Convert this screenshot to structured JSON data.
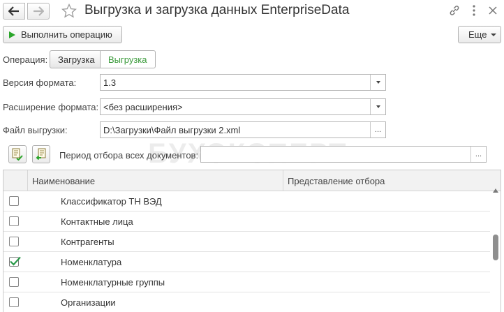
{
  "window": {
    "title": "Выгрузка и загрузка данных EnterpriseData",
    "back_icon": "arrow-left-icon",
    "forward_icon": "arrow-right-icon",
    "favorite_icon": "star-icon",
    "link_icon": "link-icon",
    "menu_icon": "more-vertical-icon",
    "close_icon": "close-icon"
  },
  "toolbar": {
    "run_label": "Выполнить операцию",
    "more_label": "Еще"
  },
  "operation": {
    "label": "Операция:",
    "options": [
      "Загрузка",
      "Выгрузка"
    ],
    "selected": "Выгрузка"
  },
  "fields": {
    "format_version": {
      "label": "Версия формата:",
      "value": "1.3"
    },
    "format_extension": {
      "label": "Расширение формата:",
      "value": "<без расширения>"
    },
    "export_file": {
      "label": "Файл выгрузки:",
      "value": "D:\\Загрузки\\Файл выгрузки 2.xml",
      "button": "..."
    }
  },
  "period": {
    "label": "Период отбора всех документов:",
    "value": "",
    "button": "...",
    "check_all_icon": "check-all-icon",
    "uncheck_all_icon": "uncheck-all-icon"
  },
  "watermark": "БУХЭКСПЕРТ",
  "table": {
    "columns": [
      "Наименование",
      "Представление отбора"
    ],
    "rows": [
      {
        "name": "Классификатор ТН ВЭД",
        "checked": false
      },
      {
        "name": "Контактные лица",
        "checked": false
      },
      {
        "name": "Контрагенты",
        "checked": false
      },
      {
        "name": "Номенклатура",
        "checked": true
      },
      {
        "name": "Номенклатурные группы",
        "checked": false
      },
      {
        "name": "Организации",
        "checked": false
      }
    ]
  },
  "colors": {
    "accent_green": "#3b9b3b",
    "run_icon_green": "#2aa52a",
    "border": "#b0b0b0"
  }
}
